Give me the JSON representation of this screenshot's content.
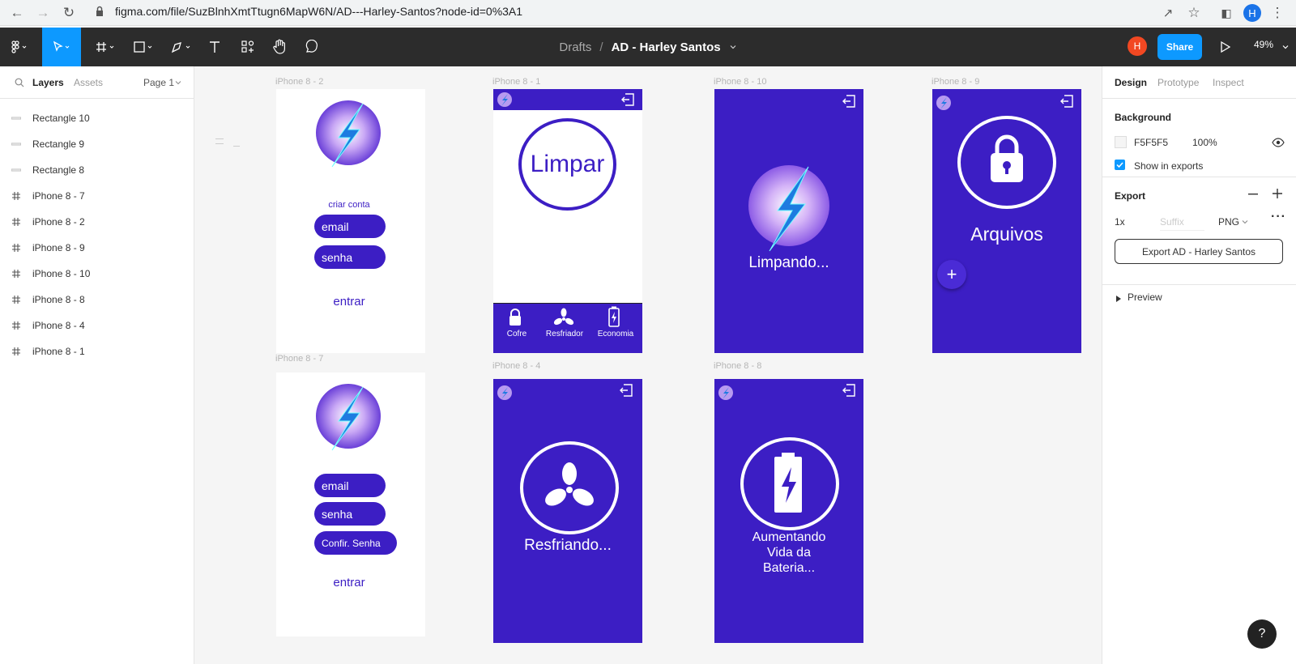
{
  "browser": {
    "url": "figma.com/file/SuzBlnhXmtTtugn6MapW6N/AD---Harley-Santos?node-id=0%3A1",
    "profile_initial": "H"
  },
  "toolbar": {
    "breadcrumb_drafts": "Drafts",
    "breadcrumb_sep": "/",
    "file_title": "AD - Harley Santos",
    "user_initial": "H",
    "share_label": "Share",
    "zoom": "49%"
  },
  "left_panel": {
    "tab_layers": "Layers",
    "tab_assets": "Assets",
    "page": "Page 1",
    "layers": [
      {
        "name": "Rectangle 10",
        "kind": "rect"
      },
      {
        "name": "Rectangle 9",
        "kind": "rect"
      },
      {
        "name": "Rectangle 8",
        "kind": "rect"
      },
      {
        "name": "iPhone 8 - 7",
        "kind": "frame"
      },
      {
        "name": "iPhone 8 - 2",
        "kind": "frame"
      },
      {
        "name": "iPhone 8 - 9",
        "kind": "frame"
      },
      {
        "name": "iPhone 8 - 10",
        "kind": "frame"
      },
      {
        "name": "iPhone 8 - 8",
        "kind": "frame"
      },
      {
        "name": "iPhone 8 - 4",
        "kind": "frame"
      },
      {
        "name": "iPhone 8 - 1",
        "kind": "frame"
      }
    ]
  },
  "canvas": {
    "frames": {
      "f2": {
        "label": "iPhone 8 - 2",
        "criar_conta": "criar conta",
        "email": "email",
        "senha": "senha",
        "entrar": "entrar"
      },
      "f1": {
        "label": "iPhone 8 - 1",
        "limpar": "Limpar",
        "nav_cofre": "Cofre",
        "nav_resfriador": "Resfriador",
        "nav_economia": "Economia"
      },
      "f10": {
        "label": "iPhone 8 - 10",
        "text": "Limpando..."
      },
      "f9": {
        "label": "iPhone 8 - 9",
        "text": "Arquivos",
        "fab": "+"
      },
      "f7": {
        "label": "iPhone 8 - 7",
        "email": "email",
        "senha": "senha",
        "confir": "Confir. Senha",
        "entrar": "entrar"
      },
      "f4": {
        "label": "iPhone 8 - 4",
        "text": "Resfriando..."
      },
      "f8": {
        "label": "iPhone 8 - 8",
        "text_l1": "Aumentando",
        "text_l2": "Vida da",
        "text_l3": "Bateria..."
      }
    }
  },
  "right_panel": {
    "tab_design": "Design",
    "tab_prototype": "Prototype",
    "tab_inspect": "Inspect",
    "background_title": "Background",
    "bg_hex": "F5F5F5",
    "bg_opacity": "100%",
    "show_in_exports": "Show in exports",
    "export_title": "Export",
    "export_scale": "1x",
    "export_suffix_placeholder": "Suffix",
    "export_format": "PNG",
    "export_button": "Export AD - Harley Santos",
    "preview": "Preview"
  },
  "help": "?",
  "colors": {
    "frame_blue": "#3c1ec4",
    "figma_blue": "#0d99ff",
    "toolbar_bg": "#2c2c2c",
    "canvas_bg": "#f5f5f5"
  }
}
